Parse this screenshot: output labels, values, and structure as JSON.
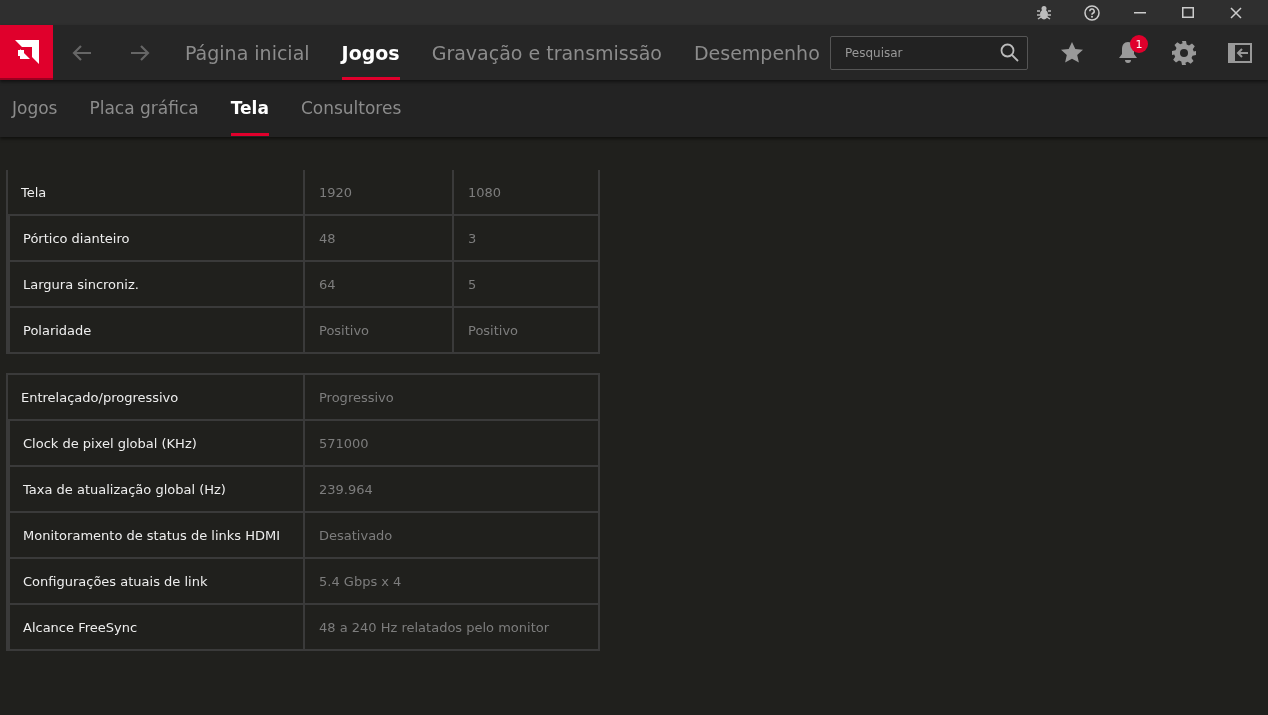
{
  "nav": {
    "items": [
      {
        "label": "Página inicial",
        "selected": false
      },
      {
        "label": "Jogos",
        "selected": true
      },
      {
        "label": "Gravação e transmissão",
        "selected": false
      },
      {
        "label": "Desempenho",
        "selected": false
      }
    ],
    "search": {
      "placeholder": "Pesquisar"
    },
    "notification_count": "1"
  },
  "subtabs": [
    {
      "label": "Jogos",
      "selected": false
    },
    {
      "label": "Placa gráfica",
      "selected": false
    },
    {
      "label": "Tela",
      "selected": true
    },
    {
      "label": "Consultores",
      "selected": false
    }
  ],
  "tables": [
    {
      "top_border": false,
      "rows": [
        {
          "label": "Tela",
          "values": [
            "1920",
            "1080"
          ]
        },
        {
          "label": "Pórtico dianteiro",
          "values": [
            "48",
            "3"
          ]
        },
        {
          "label": "Largura sincroniz.",
          "values": [
            "64",
            "5"
          ]
        },
        {
          "label": "Polaridade",
          "values": [
            "Positivo",
            "Positivo"
          ]
        }
      ]
    },
    {
      "top_border": true,
      "rows": [
        {
          "label": "Entrelaçado/progressivo",
          "values": [
            "Progressivo"
          ]
        },
        {
          "label": "Clock de pixel global (KHz)",
          "values": [
            "571000"
          ]
        },
        {
          "label": "Taxa de atualização global (Hz)",
          "values": [
            "239.964"
          ]
        },
        {
          "label": "Monitoramento de status de links HDMI",
          "values": [
            "Desativado"
          ]
        },
        {
          "label": "Configurações atuais de link",
          "values": [
            "5.4 Gbps x 4"
          ]
        },
        {
          "label": "Alcance FreeSync",
          "values": [
            "48 a 240 Hz relatados pelo monitor"
          ]
        }
      ]
    }
  ]
}
